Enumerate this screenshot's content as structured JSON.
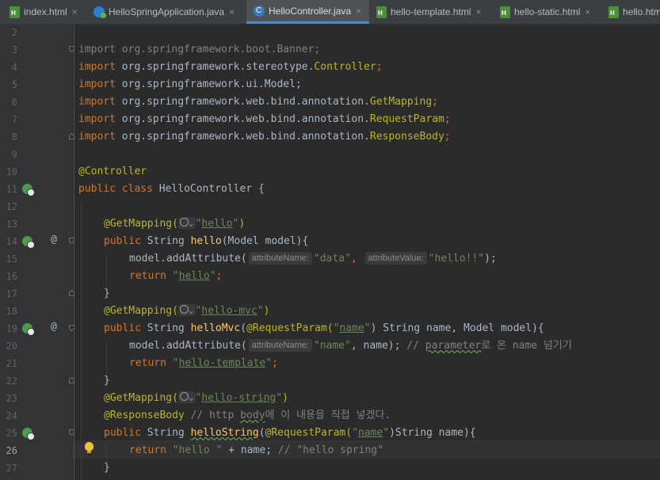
{
  "tabs": [
    {
      "label": "index.html",
      "icon": "html-file-icon"
    },
    {
      "label": "HelloSpringApplication.java",
      "icon": "spring-boot-icon"
    },
    {
      "label": "HelloController.java",
      "icon": "java-class-icon",
      "active": true
    },
    {
      "label": "hello-template.html",
      "icon": "html-file-icon"
    },
    {
      "label": "hello-static.html",
      "icon": "html-file-icon"
    },
    {
      "label": "hello.htm",
      "icon": "html-file-icon"
    }
  ],
  "close_glyph": "×",
  "line_numbers": [
    "2",
    "3",
    "4",
    "5",
    "6",
    "7",
    "8",
    "9",
    "10",
    "11",
    "12",
    "13",
    "14",
    "15",
    "16",
    "17",
    "18",
    "19",
    "20",
    "21",
    "22",
    "23",
    "24",
    "25",
    "26",
    "27"
  ],
  "current_line": "26",
  "code": {
    "imp": "import",
    "pkg_banner": " org.springframework.boot.Banner;",
    "pkg_ctrl_a": " org.springframework.stereotype.",
    "pkg_ctrl_b": "Controller",
    "semi": ";",
    "pkg_model": " org.springframework.ui.Model;",
    "pkg_web": " org.springframework.web.bind.annotation.",
    "getmapping": "GetMapping",
    "requestparam": "RequestParam",
    "responsebody": "ResponseBody",
    "ann_controller": "@Controller",
    "kw_public": "public",
    "kw_class": "class",
    "class_decl": " HelloController {",
    "ann_getmapping": "@GetMapping(",
    "globe_arrow": "⌄",
    "close_paren": ")",
    "q": "\"",
    "str_hello": "hello",
    "str_hello_mvc": "hello-mvc",
    "str_hello_string": "hello-string",
    "str_hello_template": "hello-template",
    "str_name": "name",
    "string_type": " String ",
    "m_hello": "hello",
    "p_hello": "(Model model){",
    "model_add": "model.addAttribute(",
    "hint_attr_name": "attributeName:",
    "hint_attr_value": "attributeValue:",
    "str_data": "\"data\"",
    "comma": ", ",
    "str_hello_bang": "\"hello!!\"",
    "end_call": ");",
    "kw_return": "return",
    "close_brace": "}",
    "m_hello_mvc": "helloMvc",
    "open_paren": "(",
    "ann_requestparam": "@RequestParam(",
    "p_mvc_rest": ") String name, Model model){",
    "str_name_q": "\"name\"",
    "name_end": ", name); ",
    "cmt_slashes": "// ",
    "cmt_param": "parameter",
    "cmt_param_rest": "로 온 name 넘기기",
    "ann_responsebody": "@ResponseBody",
    "cmt_body_a": " // http ",
    "cmt_body_b": "body",
    "cmt_body_c": "에 이 내용을 직접 넣겠다.",
    "m_hello_string": "helloString",
    "p_string_rest": ")String name){",
    "str_hello_sp": "\"hello \"",
    "plus_name": " + name; ",
    "cmt_hello_spring": "// \"hello spring\"",
    "at_glyph": "@"
  }
}
